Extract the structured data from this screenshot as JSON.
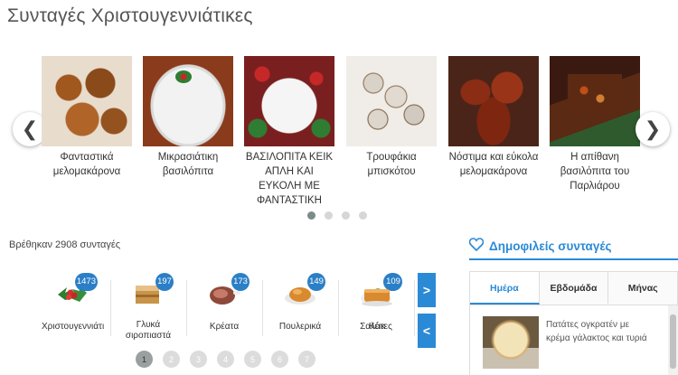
{
  "page": {
    "title": "Συνταγές Χριστουγεννιάτικες"
  },
  "carousel": {
    "items": [
      {
        "caption": "Φανταστικά μελομακάρονα",
        "icon": "melomakarona-photo"
      },
      {
        "caption": "Μικρασιάτικη βασιλόπιτα",
        "icon": "vasilopita-photo"
      },
      {
        "caption": "ΒΑΣΙΛΟΠΙΤΑ ΚΕΙΚ ΑΠΛΗ ΚΑΙ ΕΥΚΟΛΗ ΜΕ ΦΑΝΤΑΣΤΙΚΗ",
        "icon": "vasilopita-keik-photo"
      },
      {
        "caption": "Τρουφάκια μπισκότου",
        "icon": "troufakia-photo"
      },
      {
        "caption": "Νόστιμα και εύκολα μελομακάρονα",
        "icon": "melomakarona-2-photo"
      },
      {
        "caption": "Η απίθανη βασιλόπιτα του Παρλιάρου",
        "icon": "vasilopita-parliarou-photo"
      }
    ],
    "prev_symbol": "❮",
    "next_symbol": "❯",
    "dots": 4,
    "active_dot": 0
  },
  "results": {
    "count_text": "Βρέθηκαν 2908 συνταγές"
  },
  "categories": [
    {
      "label": "Χριστουγεννιάτι",
      "count": "1473",
      "icon": "holly-icon"
    },
    {
      "label": "Γλυκά σιροπιαστά",
      "count": "197",
      "icon": "cake-slice-icon"
    },
    {
      "label": "Κρέατα",
      "count": "173",
      "icon": "meat-icon"
    },
    {
      "label": "Πουλερικά",
      "count": "149",
      "icon": "chicken-icon"
    },
    {
      "label": "Σαλάτες",
      "count": "139",
      "icon": "salad-icon"
    },
    {
      "label": "Κέικ",
      "count": "109",
      "icon": "cake-icon"
    }
  ],
  "category_nav": {
    "next_label": ">",
    "prev_label": "<"
  },
  "pagination": [
    "1",
    "2",
    "3",
    "4",
    "5",
    "6",
    "7"
  ],
  "popular": {
    "title": "Δημοφιλείς συνταγές",
    "tabs": [
      "Ημέρα",
      "Εβδομάδα",
      "Μήνας"
    ],
    "active_tab": 0,
    "items": [
      {
        "text": "Πατάτες ογκρατέν με κρέμα γάλακτος και τυριά"
      }
    ]
  },
  "colors": {
    "accent": "#2b8ad6",
    "badge": "#2b7fc6"
  }
}
